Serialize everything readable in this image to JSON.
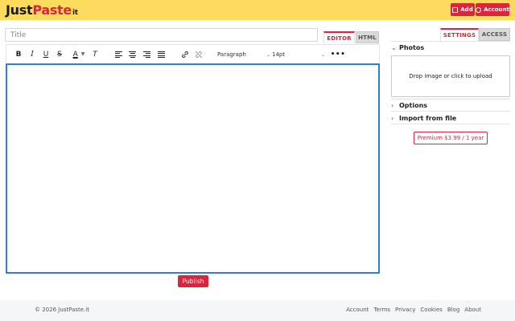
{
  "header": {
    "logo_just": "Just",
    "logo_paste": "Paste",
    "logo_it": "it",
    "add_label": "Add",
    "account_label": "Account"
  },
  "editor": {
    "title_placeholder": "Title",
    "tabs": [
      {
        "label": "EDITOR",
        "active": true
      },
      {
        "label": "HTML",
        "active": false
      }
    ],
    "toolbar": {
      "bold": "B",
      "italic": "I",
      "underline": "U",
      "strikethrough": "S",
      "text_color": "A",
      "clear_format": "T",
      "format_select": "Paragraph",
      "size_select": "14pt",
      "more": "•••"
    },
    "publish_label": "Publish"
  },
  "sidebar": {
    "tabs": [
      {
        "label": "SETTINGS",
        "active": true
      },
      {
        "label": "ACCESS",
        "active": false
      }
    ],
    "photos_label": "Photos",
    "dropzone_text": "Drop image or click to upload",
    "options_label": "Options",
    "import_label": "Import from file",
    "premium_label": "Premium $3.99 / 1 year"
  },
  "footer": {
    "copyright": "© 2026 JustPaste.it",
    "links": [
      "Account",
      "Terms",
      "Privacy",
      "Cookies",
      "Blog",
      "About"
    ]
  },
  "colors": {
    "header_bg": "#fddb5f",
    "accent": "#d9263c",
    "editor_focus": "#2f7fd0"
  }
}
